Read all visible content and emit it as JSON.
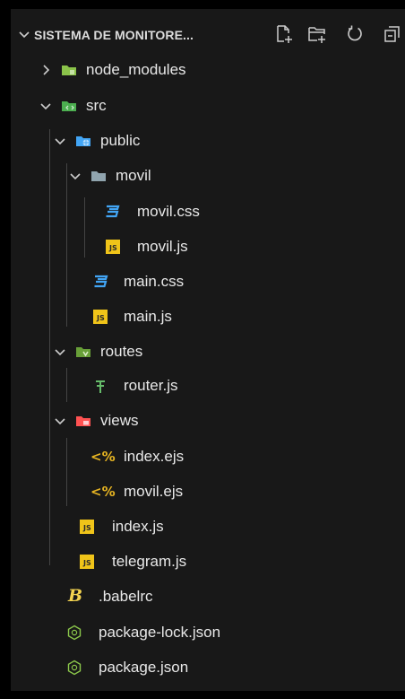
{
  "explorer": {
    "folder_title": "SISTEMA DE MONITORE...",
    "actions": {
      "new_file_icon": "new-file-icon",
      "new_folder_icon": "new-folder-icon",
      "refresh_icon": "refresh-icon",
      "collapse_icon": "collapse-all-icon"
    }
  },
  "tree": [
    {
      "label": "node_modules",
      "type": "folder",
      "state": "collapsed",
      "depth": 0,
      "icon": "folder-node-icon"
    },
    {
      "label": "src",
      "type": "folder",
      "state": "expanded",
      "depth": 0,
      "icon": "folder-src-icon"
    },
    {
      "label": "public",
      "type": "folder",
      "state": "expanded",
      "depth": 1,
      "icon": "folder-public-icon"
    },
    {
      "label": "movil",
      "type": "folder",
      "state": "expanded",
      "depth": 2,
      "icon": "folder-icon"
    },
    {
      "label": "movil.css",
      "type": "file",
      "depth": 3,
      "icon": "css-icon"
    },
    {
      "label": "movil.js",
      "type": "file",
      "depth": 3,
      "icon": "js-icon"
    },
    {
      "label": "main.css",
      "type": "file",
      "depth": 2,
      "icon": "css-icon"
    },
    {
      "label": "main.js",
      "type": "file",
      "depth": 2,
      "icon": "js-icon"
    },
    {
      "label": "routes",
      "type": "folder",
      "state": "expanded",
      "depth": 1,
      "icon": "folder-routes-icon"
    },
    {
      "label": "router.js",
      "type": "file",
      "depth": 2,
      "icon": "router-icon"
    },
    {
      "label": "views",
      "type": "folder",
      "state": "expanded",
      "depth": 1,
      "icon": "folder-views-icon"
    },
    {
      "label": "index.ejs",
      "type": "file",
      "depth": 2,
      "icon": "ejs-icon"
    },
    {
      "label": "movil.ejs",
      "type": "file",
      "depth": 2,
      "icon": "ejs-icon"
    },
    {
      "label": "index.js",
      "type": "file",
      "depth": 1,
      "icon": "js-icon"
    },
    {
      "label": "telegram.js",
      "type": "file",
      "depth": 1,
      "icon": "js-icon"
    },
    {
      "label": ".babelrc",
      "type": "file",
      "depth": 0,
      "icon": "babel-icon"
    },
    {
      "label": "package-lock.json",
      "type": "file",
      "depth": 0,
      "icon": "nodejs-icon"
    },
    {
      "label": "package.json",
      "type": "file",
      "depth": 0,
      "icon": "nodejs-icon"
    }
  ],
  "icon_text": {
    "js": "JS",
    "ejs": "<%"
  },
  "colors": {
    "background": "#181818",
    "text": "#e8e8e8",
    "js_yellow": "#f0c419",
    "css_blue": "#42a5f5",
    "folder_node_green": "#8bc34a",
    "folder_src_green": "#4caf50",
    "folder_public_blue": "#42a5f5",
    "folder_views_red": "#ff5252",
    "node_green": "#8cc84b"
  }
}
